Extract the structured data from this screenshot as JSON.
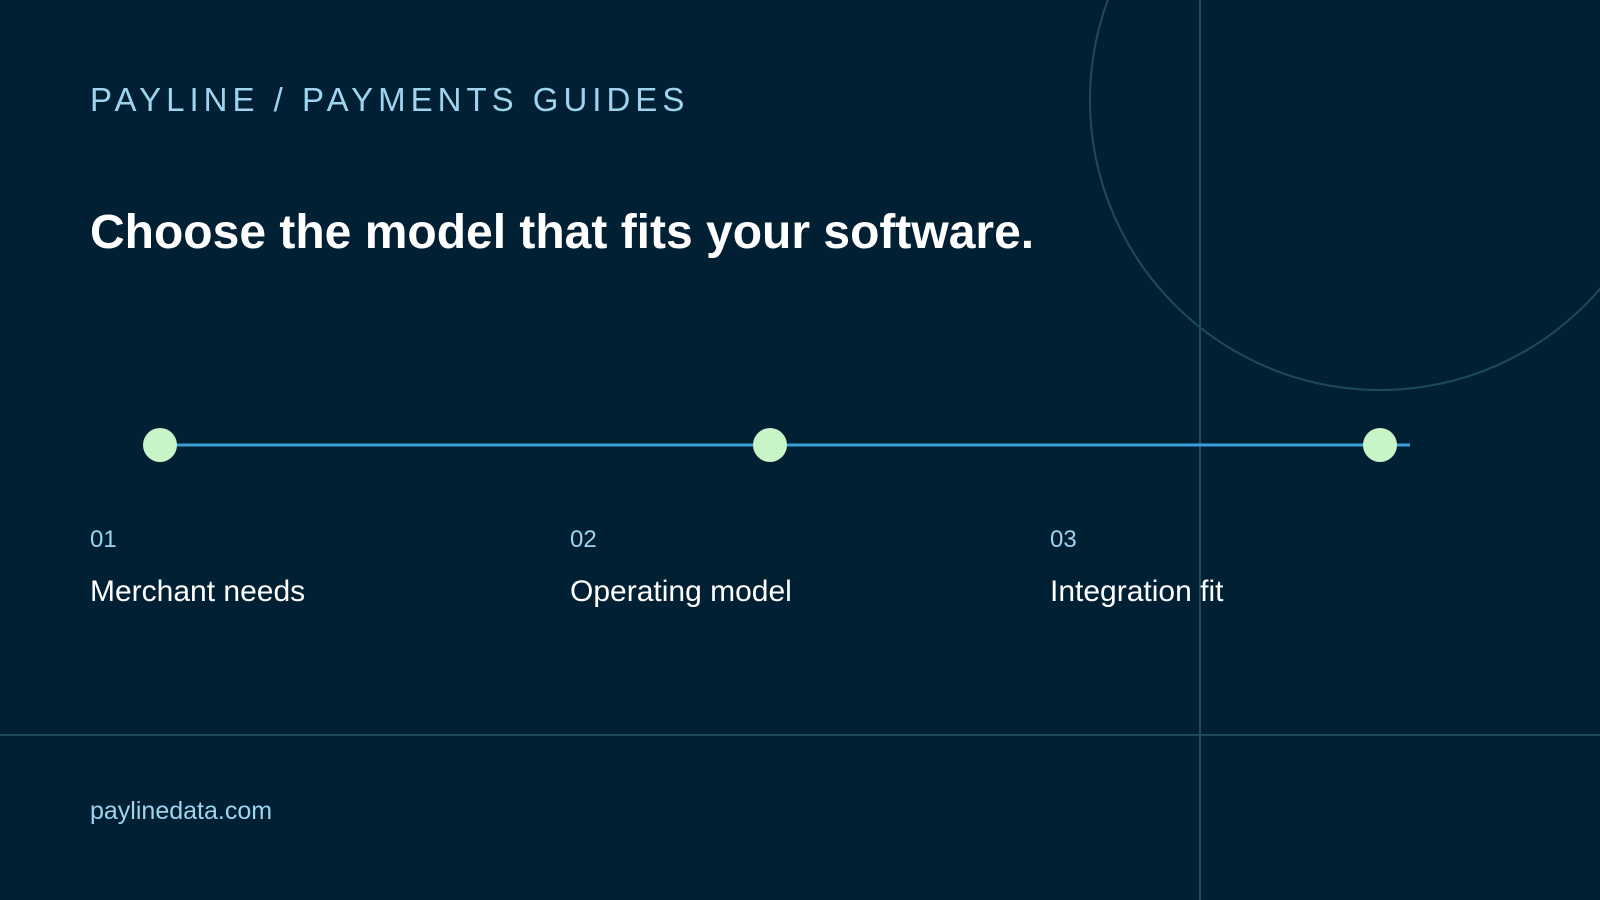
{
  "header": {
    "eyebrow": "PAYLINE / PAYMENTS GUIDES",
    "title": "Choose the model that fits your software."
  },
  "steps": [
    {
      "number": "01",
      "label": "Merchant needs"
    },
    {
      "number": "02",
      "label": "Operating model"
    },
    {
      "number": "03",
      "label": "Integration fit"
    }
  ],
  "footer": {
    "url": "paylinedata.com"
  },
  "colors": {
    "background": "#012033",
    "accent_line": "#3a9fd8",
    "node": "#c8f5c8",
    "muted_text": "#9fd4ef",
    "decor_lines": "#1f4a5e"
  }
}
